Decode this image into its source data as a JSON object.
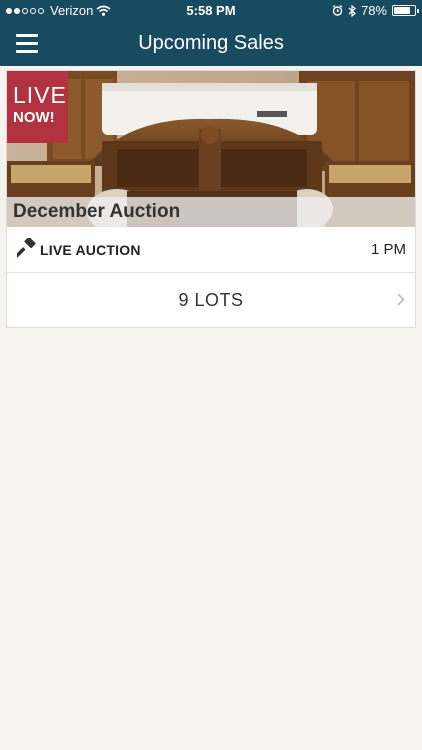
{
  "status_bar": {
    "carrier": "Verizon",
    "time": "5:58 PM",
    "battery": "78%",
    "battery_level": 0.78,
    "signal_bars": 2
  },
  "nav": {
    "title": "Upcoming Sales",
    "menu_icon": "hamburger-menu-icon"
  },
  "sale": {
    "badge_line1": "LIVE",
    "badge_line2": "NOW!",
    "name": "December Auction",
    "type_label": "LIVE AUCTION",
    "type_icon": "gavel-icon",
    "time": "1 PM",
    "lots": "9 LOTS"
  },
  "colors": {
    "header": "#184a60",
    "badge": "#b2323f",
    "background": "#f4f3ef"
  }
}
